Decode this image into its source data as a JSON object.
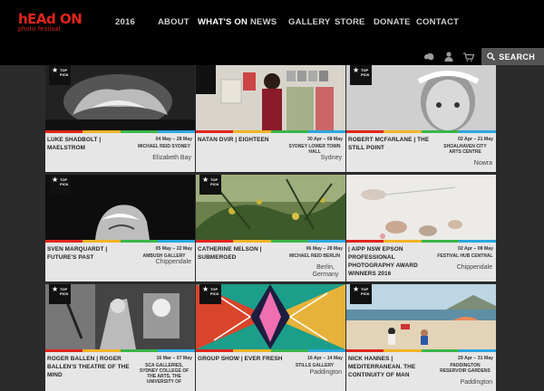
{
  "logo": {
    "line1": "hEAd ON",
    "line2": "photo festival"
  },
  "nav": {
    "items": [
      {
        "label": "2016"
      },
      {
        "label": "ABOUT"
      },
      {
        "label": "WHAT'S ON"
      },
      {
        "label": "NEWS"
      },
      {
        "label": "GALLERY"
      },
      {
        "label": "STORE"
      },
      {
        "label": "DONATE"
      },
      {
        "label": "CONTACT"
      }
    ],
    "active": "WHAT'S ON"
  },
  "utils": {
    "search_label": "SEARCH",
    "icons": [
      "australia-icon",
      "user-icon",
      "cart-icon",
      "search-icon"
    ]
  },
  "colors": {
    "accent": "#e1251b",
    "bar": [
      "#e1251b",
      "#f2b325",
      "#3ab54a",
      "#2aa7df"
    ]
  },
  "top_pick": {
    "line1": "TOP",
    "line2": "PICK"
  },
  "cards": [
    {
      "title": "LUKE SHADBOLT | MAELSTROM",
      "date": "04 May – 28 May",
      "venue": "MICHAEL REID SYDNEY",
      "city": "Elizabeth Bay",
      "top_pick": true
    },
    {
      "title": "NATAN DVIR | EIGHTEEN",
      "date": "30 Apr – 08 May",
      "venue": "SYDNEY LOWER TOWN HALL",
      "city": "Sydney",
      "top_pick": false
    },
    {
      "title": "ROBERT MCFARLANE | THE STILL POINT",
      "date": "02 Apr – 21 May",
      "venue": "SHOALHAVEN CITY ARTS CENTRE",
      "city": "Nowra",
      "top_pick": true
    },
    {
      "title": "SVEN MARQUARDT | FUTURE'S PAST",
      "date": "05 May – 22 May",
      "venue": "AMBUSH GALLERY",
      "city": "Chippendale",
      "top_pick": true
    },
    {
      "title": "CATHERINE NELSON | SUBMERGED",
      "date": "06 May – 28 May",
      "venue": "MICHAEL REID BERLIN",
      "city": "Berlin, Germany",
      "top_pick": true
    },
    {
      "title": "| AIPP NSW EPSON PROFESSIONAL PHOTOGRAPHY AWARD WINNERS 2016",
      "date": "02 Apr – 08 May",
      "venue": "FESTIVAL HUB CENTRAL",
      "city": "Chippendale",
      "top_pick": false
    },
    {
      "title": "ROGER BALLEN | ROGER BALLEN'S THEATRE OF THE MIND",
      "date": "16 Mar – 07 May",
      "venue": "SCA GALLERIES, SYDNEY COLLEGE OF THE ARTS, THE UNIVERSITY OF",
      "city": "",
      "top_pick": true
    },
    {
      "title": "GROUP SHOW | EVER FRESH",
      "date": "16 Apr – 14 May",
      "venue": "STILLS GALLERY",
      "city": "Paddington",
      "top_pick": true
    },
    {
      "title": "NICK HANNES | MEDITERRANEAN. THE CONTINUITY OF MAN",
      "date": "29 Apr – 31 May",
      "venue": "PADDINGTON RESERVOIR GARDENS",
      "city": "Paddington",
      "top_pick": true
    }
  ]
}
